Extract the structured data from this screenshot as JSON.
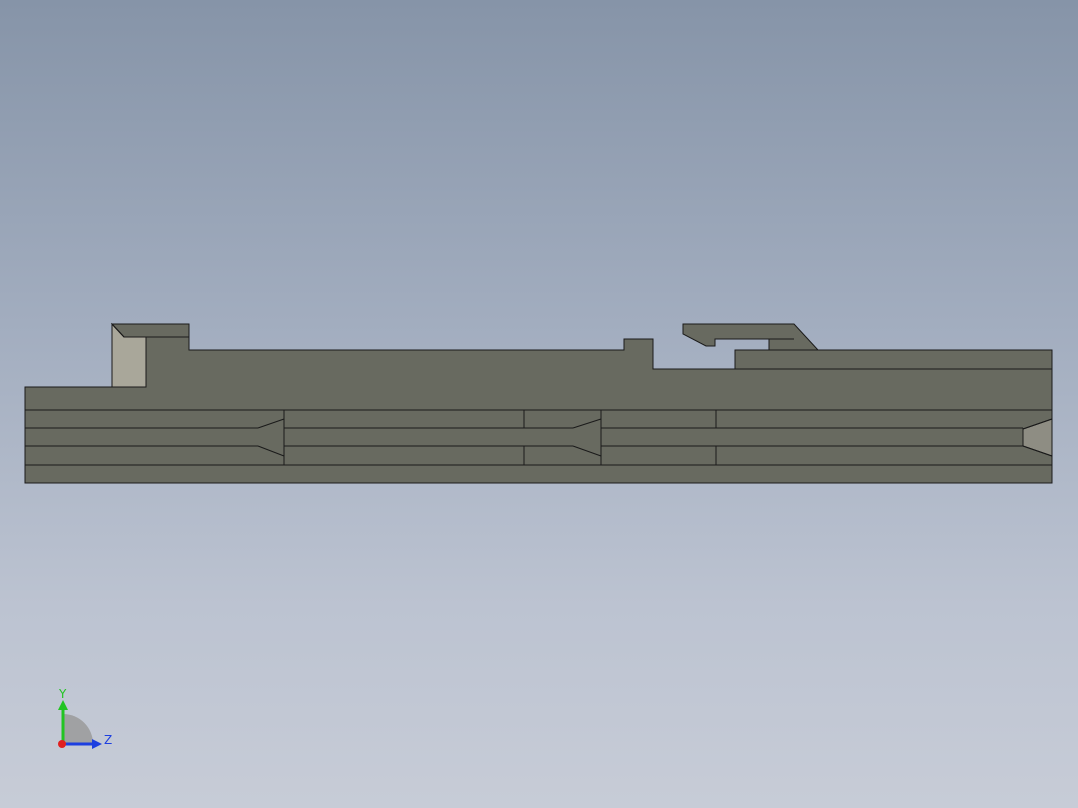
{
  "viewport": {
    "background_top": "#8694a8",
    "background_bottom": "#c7ccd7"
  },
  "model": {
    "face_color": "#686a60",
    "edge_color": "#1a1a1a",
    "light_face_color": "#a9a79a",
    "highlight_face_color": "#8e8d83"
  },
  "triad": {
    "y_label": "Y",
    "z_label": "Z",
    "y_color": "#22c422",
    "z_color": "#1d3fe0",
    "x_color": "#e02020"
  }
}
